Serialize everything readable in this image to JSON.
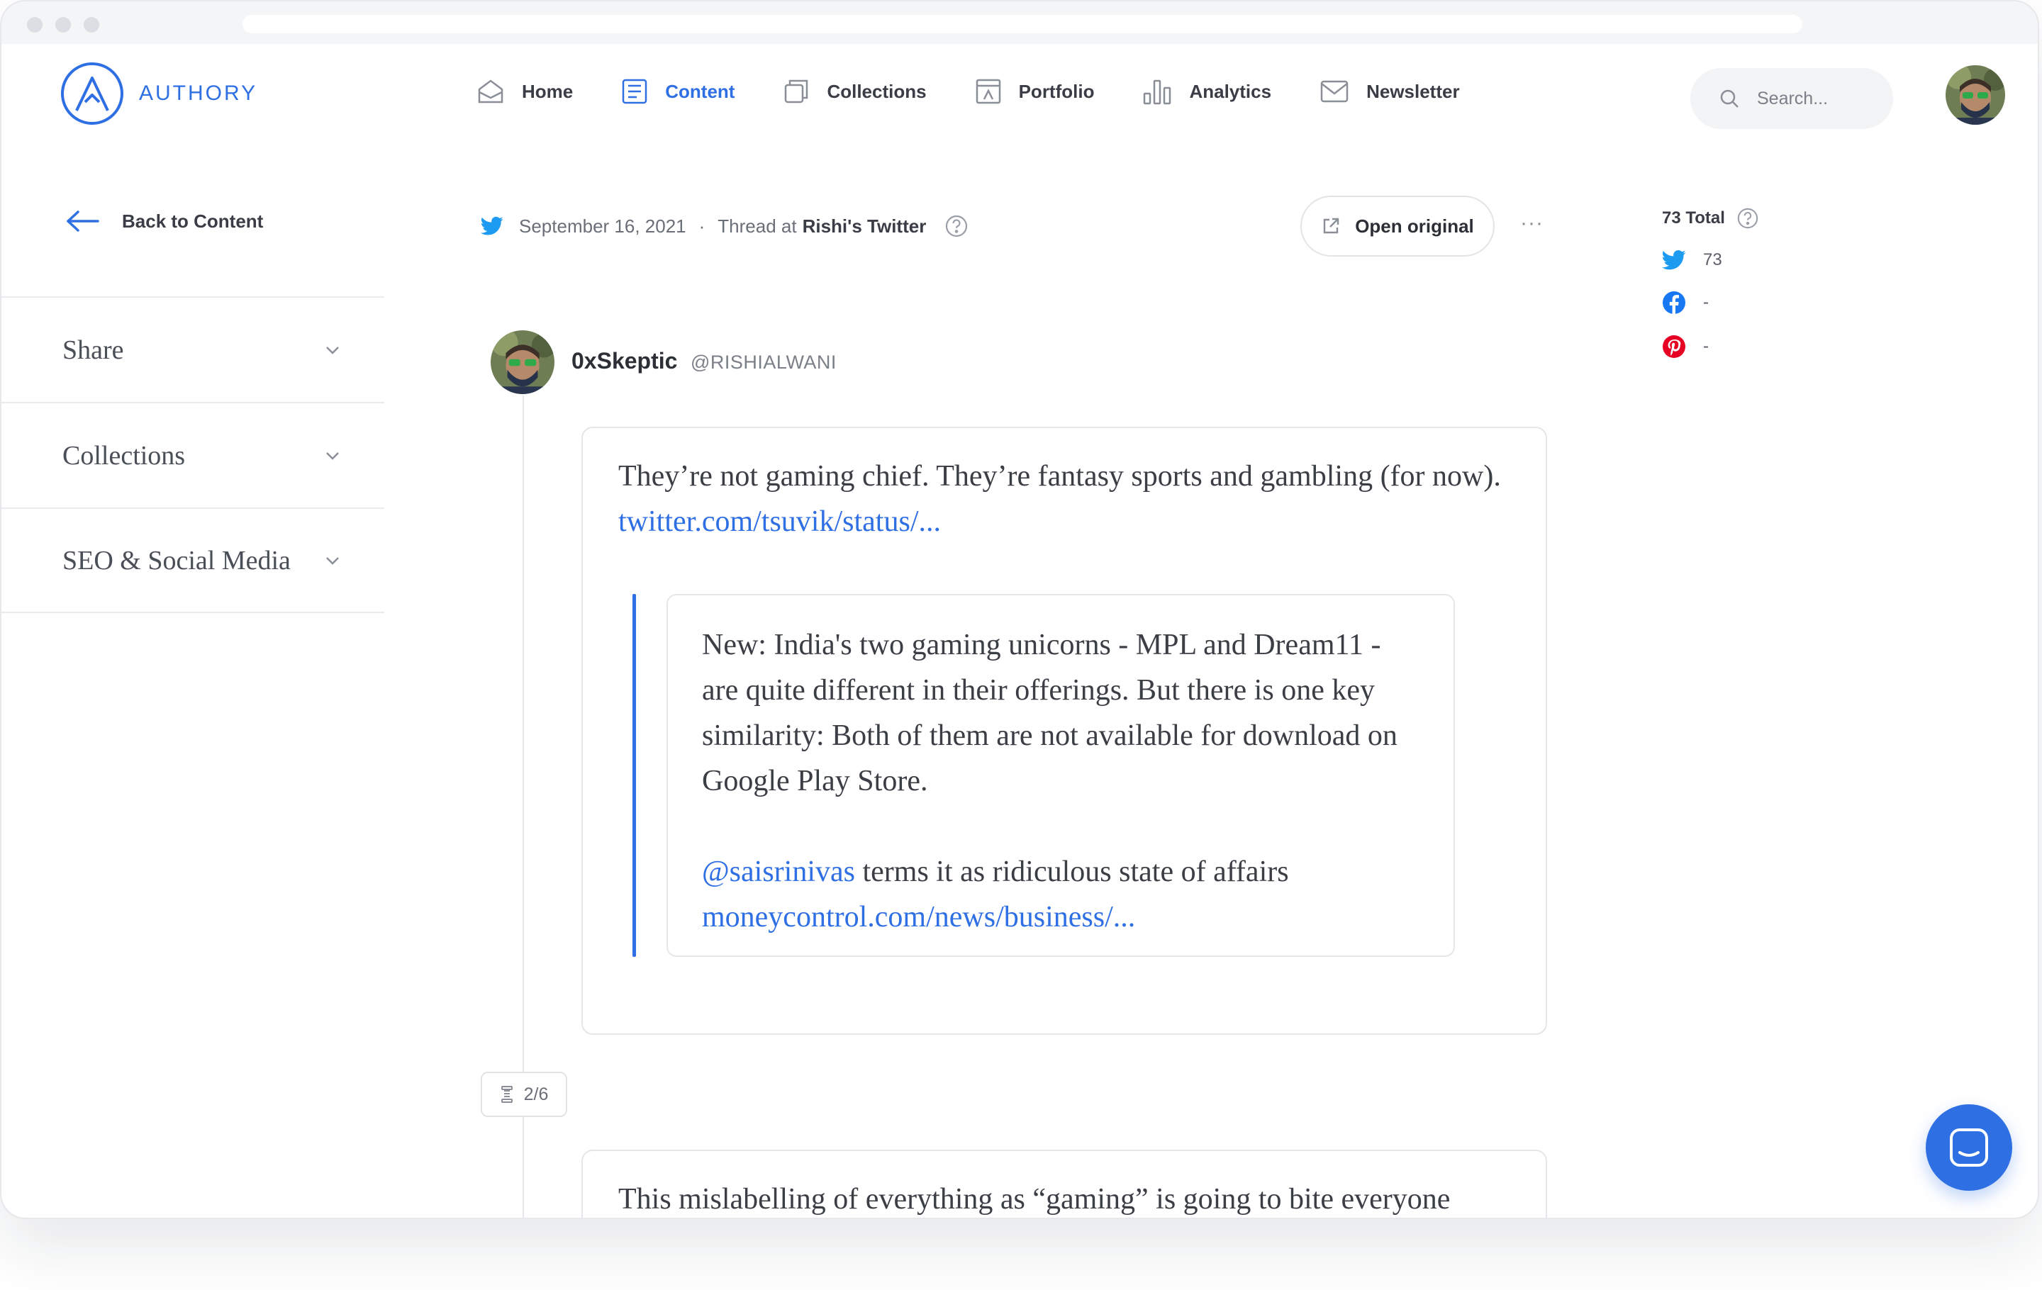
{
  "app": {
    "brand": "AUTHORY",
    "accent_color": "#2f6fe4"
  },
  "nav": {
    "items": [
      {
        "label": "Home",
        "icon": "home-icon"
      },
      {
        "label": "Content",
        "icon": "content-icon",
        "active": true
      },
      {
        "label": "Collections",
        "icon": "collections-icon"
      },
      {
        "label": "Portfolio",
        "icon": "portfolio-icon"
      },
      {
        "label": "Analytics",
        "icon": "analytics-icon"
      },
      {
        "label": "Newsletter",
        "icon": "newsletter-icon"
      }
    ]
  },
  "search": {
    "placeholder": "Search..."
  },
  "sidebar": {
    "back_label": "Back to Content",
    "sections": [
      "Share",
      "Collections",
      "SEO & Social Media"
    ]
  },
  "meta": {
    "date": "September 16, 2021",
    "separator": "·",
    "thread_prefix": "Thread at",
    "source_name": "Rishi's Twitter",
    "open_original_label": "Open original",
    "more_label": "···"
  },
  "post": {
    "author": "0xSkeptic",
    "handle": "@RISHIALWANI",
    "tweet1": {
      "text": "They’re not gaming chief. They’re fantasy sports and gambling (for now).",
      "link": "twitter.com/tsuvik/status/..."
    },
    "quote": {
      "paragraph1": "New: India's two gaming unicorns - MPL and Dream11 - are quite different in their offerings. But there is one key similarity: Both of them are not available for download on Google Play Store.",
      "mention": "@saisrinivas",
      "paragraph2_rest": "terms it as ridiculous state of affairs",
      "link": "moneycontrol.com/news/business/..."
    },
    "thread_count": "2/6",
    "tweet2": {
      "text": "This mislabelling of everything as “gaming” is going to bite everyone"
    }
  },
  "stats": {
    "total_label": "73 Total",
    "twitter": "73",
    "facebook": "-",
    "pinterest": "-",
    "twitter_color": "#1d9bf0",
    "facebook_color": "#1877f2",
    "pinterest_color": "#e60023"
  }
}
